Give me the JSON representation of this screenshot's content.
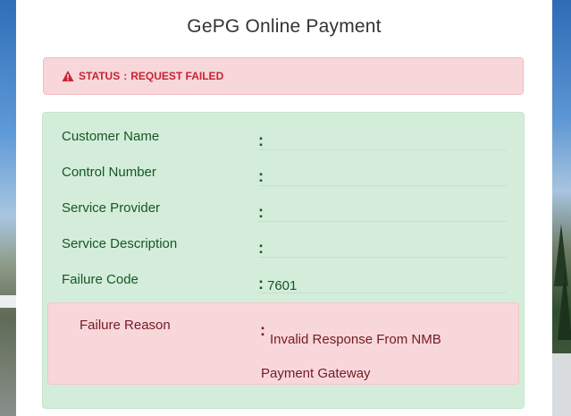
{
  "page": {
    "title": "GePG Online Payment"
  },
  "status_alert": {
    "icon": "warning-triangle-icon",
    "label": "STATUS",
    "separator": ":",
    "value": "REQUEST FAILED",
    "color": "#c82333",
    "background": "#f8d7da"
  },
  "details": {
    "background": "#d4edda",
    "rows": [
      {
        "label": "Customer Name",
        "separator": ":",
        "value": ""
      },
      {
        "label": "Control Number",
        "separator": ":",
        "value": ""
      },
      {
        "label": "Service Provider",
        "separator": ":",
        "value": ""
      },
      {
        "label": "Service Description",
        "separator": ":",
        "value": ""
      },
      {
        "label": "Failure Code",
        "separator": ":",
        "value": "7601"
      }
    ],
    "failure_reason": {
      "label": "Failure Reason",
      "separator": ":",
      "value": "Invalid Response From NMB Payment Gateway",
      "background": "#f8d7da"
    }
  }
}
